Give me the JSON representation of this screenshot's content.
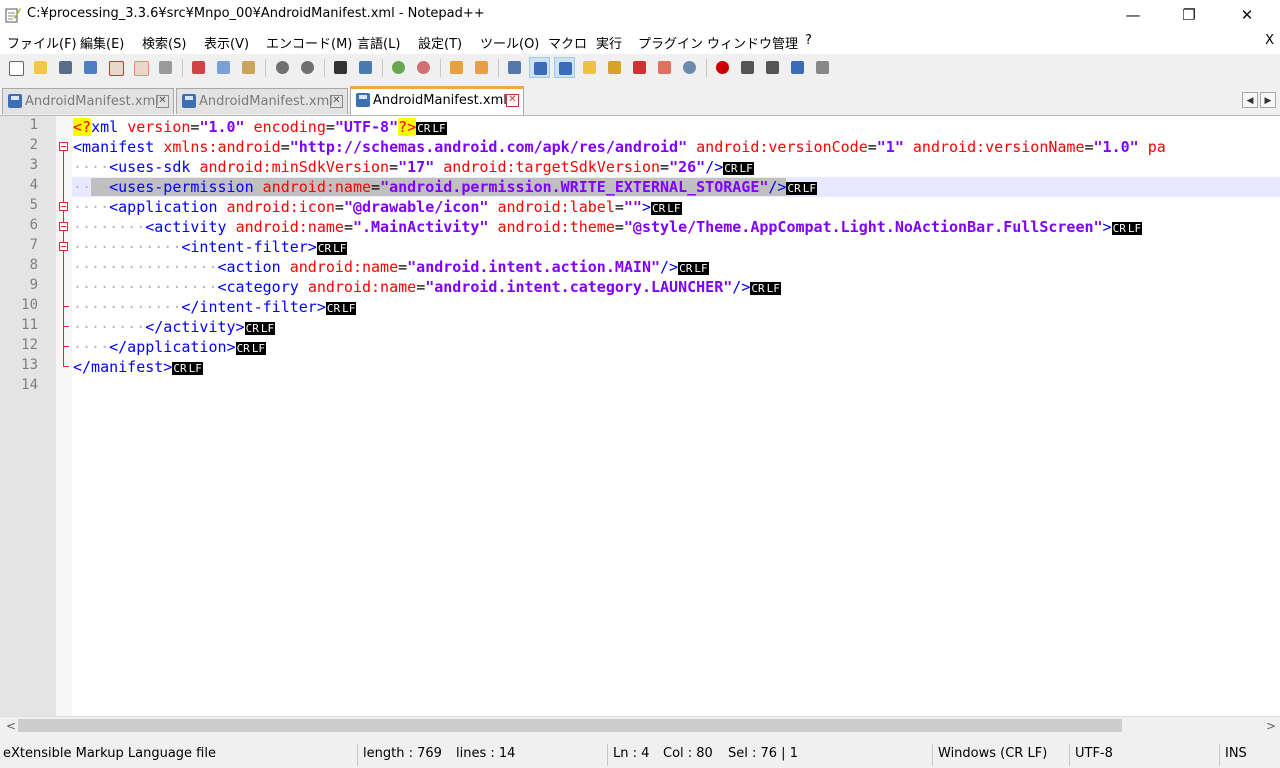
{
  "window": {
    "title": "C:¥processing_3.3.6¥src¥Mnpo_00¥AndroidManifest.xml - Notepad++",
    "minimize_glyph": "—",
    "restore_glyph": "❐",
    "close_glyph": "✕"
  },
  "menu": {
    "items": [
      "ファイル(F)",
      "編集(E)",
      "検索(S)",
      "表示(V)",
      "エンコード(M)",
      "言語(L)",
      "設定(T)",
      "ツール(O)",
      "マクロ",
      "実行",
      "プラグイン",
      "ウィンドウ管理",
      "?"
    ],
    "close_label": "X"
  },
  "toolbar": {
    "colors": {
      "accent": "#cce4f7"
    }
  },
  "tabs": [
    {
      "label": "AndroidManifest.xml",
      "close": "✕",
      "active": false
    },
    {
      "label": "AndroidManifest.xml",
      "close": "✕",
      "active": false
    },
    {
      "label": "AndroidManifest.xml",
      "close": "✕",
      "active": true
    }
  ],
  "tab_scroll": {
    "left": "◀",
    "right": "▶"
  },
  "editor": {
    "line_numbers": [
      "1",
      "2",
      "3",
      "4",
      "5",
      "6",
      "7",
      "8",
      "9",
      "10",
      "11",
      "12",
      "13",
      "14"
    ],
    "current_line": 4,
    "eol_cr": "CR",
    "eol_lf": "LF"
  },
  "code": {
    "l1": {
      "open": "<?",
      "tag": "xml",
      "a1": "version",
      "v1": "\"1.0\"",
      "a2": "encoding",
      "v2": "\"UTF-8\"",
      "close": "?>"
    },
    "l2": {
      "tag": "<manifest",
      "a1": "xmlns:android",
      "v1": "\"http://schemas.android.com/apk/res/android\"",
      "a2": "android:versionCode",
      "v2": "\"1\"",
      "a3": "android:versionName",
      "v3": "\"1.0\"",
      "a4": "pa"
    },
    "l3": {
      "tag": "<uses-sdk",
      "a1": "android:minSdkVersion",
      "v1": "\"17\"",
      "a2": "android:targetSdkVersion",
      "v2": "\"26\"",
      "close": "/>"
    },
    "l4": {
      "tag": "<uses-permission",
      "a1": "android:name",
      "v1": "\"android.permission.WRITE_EXTERNAL_STORAGE\"",
      "close": "/>"
    },
    "l5": {
      "tag": "<application",
      "a1": "android:icon",
      "v1": "\"@drawable/icon\"",
      "a2": "android:label",
      "v2": "\"\"",
      "close": ">"
    },
    "l6": {
      "tag": "<activity",
      "a1": "android:name",
      "v1": "\".MainActivity\"",
      "a2": "android:theme",
      "v2": "\"@style/Theme.AppCompat.Light.NoActionBar.FullScreen\"",
      "close": ">"
    },
    "l7": {
      "tag": "<intent-filter>"
    },
    "l8": {
      "tag": "<action",
      "a1": "android:name",
      "v1": "\"android.intent.action.MAIN\"",
      "close": "/>"
    },
    "l9": {
      "tag": "<category",
      "a1": "android:name",
      "v1": "\"android.intent.category.LAUNCHER\"",
      "close": "/>"
    },
    "l10": {
      "tag": "</intent-filter>"
    },
    "l11": {
      "tag": "</activity>"
    },
    "l12": {
      "tag": "</application>"
    },
    "l13": {
      "tag": "</manifest>"
    }
  },
  "scrollbar": {
    "left": "<",
    "right": ">"
  },
  "status": {
    "file_type": "eXtensible Markup Language file",
    "length": "length : 769",
    "lines": "lines : 14",
    "ln": "Ln : 4",
    "col": "Col : 80",
    "sel": "Sel : 76 | 1",
    "eol": "Windows (CR LF)",
    "encoding": "UTF-8",
    "mode": "INS"
  }
}
